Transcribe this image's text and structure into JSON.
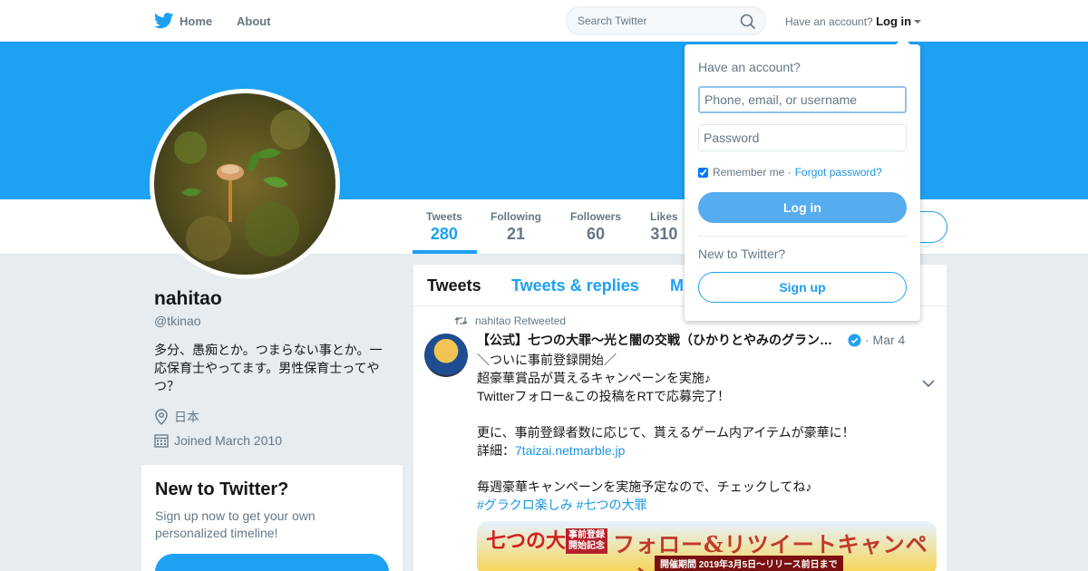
{
  "nav": {
    "home": "Home",
    "about": "About",
    "search_placeholder": "Search Twitter",
    "have_account": "Have an account?",
    "login": "Log in"
  },
  "colors": {
    "brand": "#1da1f2",
    "link": "#1b95e0",
    "login_button": "#55acee"
  },
  "profile": {
    "name": "nahitao",
    "handle": "@tkinao",
    "bio": "多分、愚痴とか。つまらない事とか。一応保育士やってます。男性保育士ってやつ？",
    "location": "日本",
    "joined": "Joined March 2010"
  },
  "stats": [
    {
      "label": "Tweets",
      "value": "280"
    },
    {
      "label": "Following",
      "value": "21"
    },
    {
      "label": "Followers",
      "value": "60"
    },
    {
      "label": "Likes",
      "value": "310"
    }
  ],
  "new_card": {
    "title": "New to Twitter?",
    "subtitle": "Sign up now to get your own personalized timeline!"
  },
  "tabs": [
    {
      "label": "Tweets"
    },
    {
      "label": "Tweets & replies"
    },
    {
      "label": "M"
    }
  ],
  "tweet": {
    "retweeted_by": "nahitao Retweeted",
    "author": "【公式】七つの大罪～光と闇の交戦（ひかりとやみのグランドクロス）～",
    "date": "· Mar 4",
    "line1": "＼ついに事前登録開始／",
    "line2": "超豪華賞品が貰えるキャンペーンを実施♪",
    "line3": "Twitterフォロー&この投稿をRTで応募完了！",
    "line4": "更に、事前登録者数に応じて、貰えるゲーム内アイテムが豪華に！",
    "line5_prefix": "詳細：",
    "line5_link": "7taizai.netmarble.jp",
    "line6": "毎週豪華キャンペーンを実施予定なので、チェックしてね♪",
    "hashtags": "#グラクロ楽しみ #七つの大罪",
    "card_logo": "七つの大罪",
    "card_badge": "事前登録開始記念",
    "card_title": "フォロー&リツイートキャンペーン",
    "card_sub": "開催期間 2019年3月5日～リリース前日まで"
  },
  "login_dropdown": {
    "title": "Have an account?",
    "username_placeholder": "Phone, email, or username",
    "password_placeholder": "Password",
    "remember": "Remember me",
    "separator": "·",
    "forgot": "Forgot password?",
    "login_button": "Log in",
    "new_to_twitter": "New to Twitter?",
    "signup_button": "Sign up"
  }
}
